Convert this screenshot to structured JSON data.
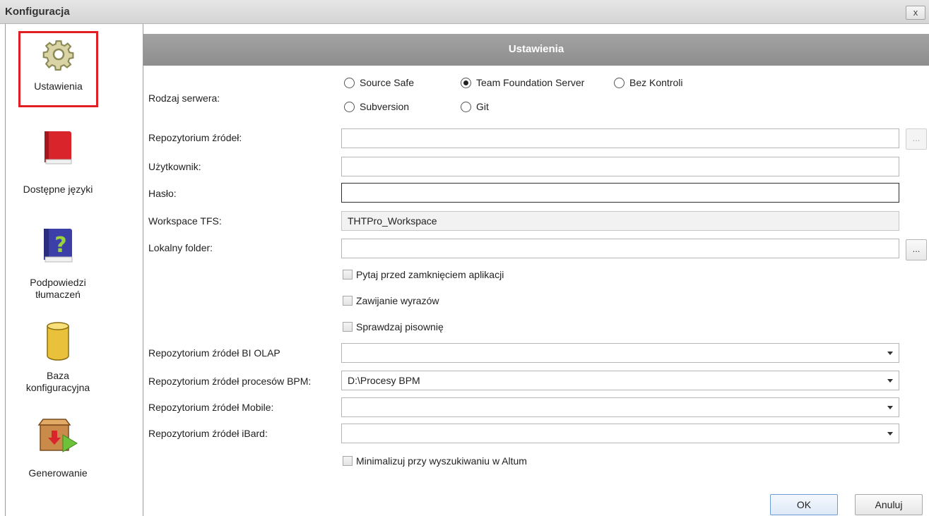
{
  "window": {
    "title": "Konfiguracja",
    "close_label": "x"
  },
  "sidebar": {
    "items": [
      {
        "label": "Ustawienia",
        "icon": "gear-icon",
        "selected": true
      },
      {
        "label": "Dostępne języki",
        "icon": "book-icon",
        "selected": false
      },
      {
        "label": "Podpowiedzi tłumaczeń",
        "label_line1": "Podpowiedzi",
        "label_line2": "tłumaczeń",
        "icon": "help-book-icon",
        "selected": false
      },
      {
        "label": "Baza konfiguracyjna",
        "label_line1": "Baza",
        "label_line2": "konfiguracyjna",
        "icon": "database-icon",
        "selected": false
      },
      {
        "label": "Generowanie",
        "icon": "generate-box-icon",
        "selected": false
      }
    ]
  },
  "header": {
    "title": "Ustawienia"
  },
  "form": {
    "server_type": {
      "label": "Rodzaj serwera:",
      "options": [
        {
          "label": "Source Safe",
          "checked": false
        },
        {
          "label": "Team Foundation Server",
          "checked": true
        },
        {
          "label": "Bez Kontroli",
          "checked": false
        },
        {
          "label": "Subversion",
          "checked": false
        },
        {
          "label": "Git",
          "checked": false
        }
      ]
    },
    "source_repo": {
      "label": "Repozytorium źródeł:",
      "value": "",
      "button": "..."
    },
    "user": {
      "label": "Użytkownik:",
      "value": ""
    },
    "password": {
      "label": "Hasło:",
      "value": ""
    },
    "workspace": {
      "label": "Workspace TFS:",
      "value": "THTPro_Workspace"
    },
    "local_folder": {
      "label": "Lokalny folder:",
      "value": "",
      "button": "..."
    },
    "checkboxes": [
      {
        "label": "Pytaj przed zamknięciem aplikacji",
        "checked": false
      },
      {
        "label": "Zawijanie wyrazów",
        "checked": false
      },
      {
        "label": "Sprawdzaj pisownię",
        "checked": false
      }
    ],
    "bi_olap": {
      "label": "Repozytorium źródeł BI OLAP",
      "value": ""
    },
    "bpm": {
      "label": "Repozytorium źródeł procesów BPM:",
      "value": "D:\\Procesy BPM"
    },
    "mobile": {
      "label": "Repozytorium źródeł Mobile:",
      "value": ""
    },
    "ibard": {
      "label": "Repozytorium źródeł iBard:",
      "value": ""
    },
    "minimize": {
      "label": "Minimalizuj przy wyszukiwaniu w Altum",
      "checked": false
    }
  },
  "buttons": {
    "ok": "OK",
    "cancel": "Anuluj"
  },
  "colors": {
    "header": "#999999",
    "selection_outline": "#e01e24",
    "primary_button": "#dde9f7"
  }
}
